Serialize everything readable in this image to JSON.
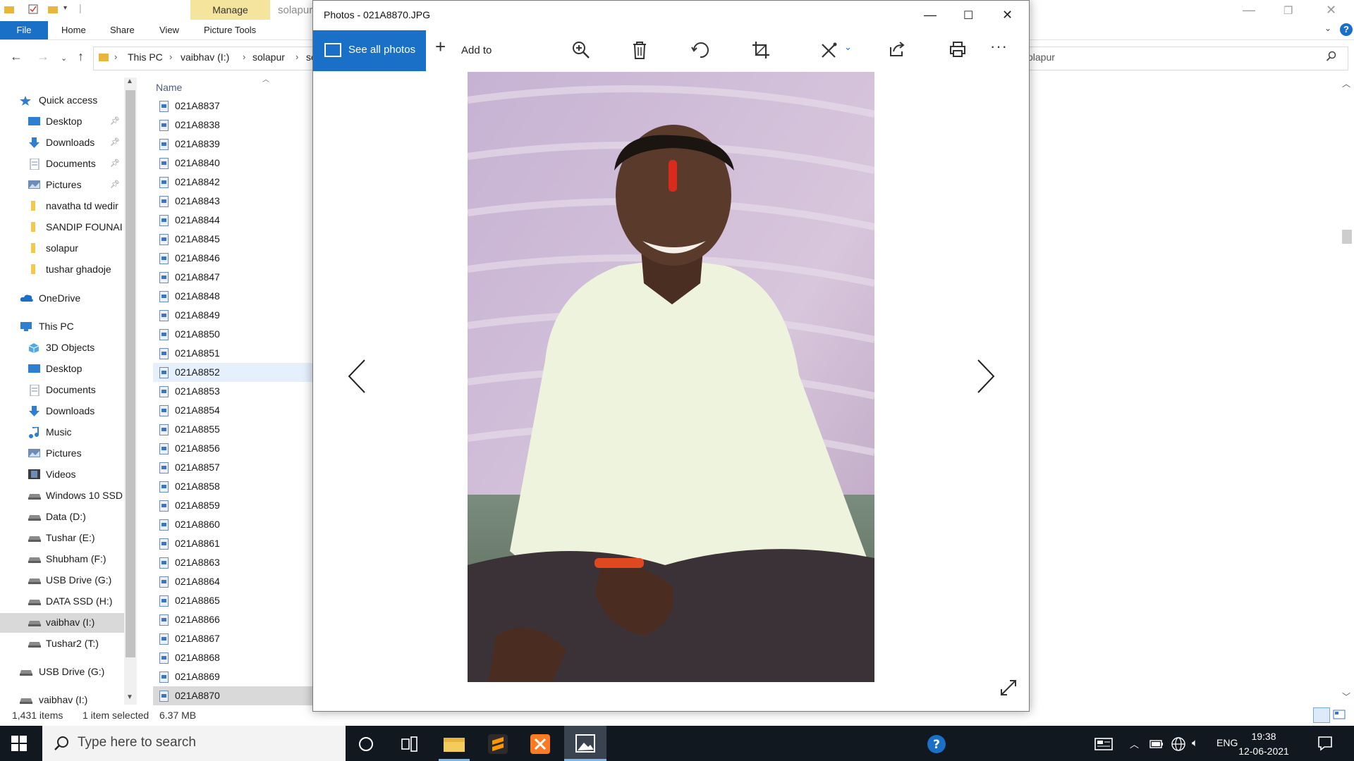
{
  "explorer": {
    "ribbon": {
      "manage_tab": "Manage",
      "file_tab": "File",
      "tabs": [
        "Home",
        "Share",
        "View",
        "Picture Tools"
      ],
      "ghost_title": "solapur"
    },
    "breadcrumb": [
      "This PC",
      "vaibhav (I:)",
      "solapur",
      "so"
    ],
    "search_text": "olapur",
    "nav_pane": [
      {
        "label": "Quick access",
        "icon": "star-icon",
        "indent": 0
      },
      {
        "label": "Desktop",
        "icon": "desktop-icon",
        "indent": 1,
        "pinned": true
      },
      {
        "label": "Downloads",
        "icon": "download-icon",
        "indent": 1,
        "pinned": true
      },
      {
        "label": "Documents",
        "icon": "documents-icon",
        "indent": 1,
        "pinned": true
      },
      {
        "label": "Pictures",
        "icon": "pictures-icon",
        "indent": 1,
        "pinned": true
      },
      {
        "label": "navatha td wedir",
        "icon": "folder-icon",
        "indent": 1
      },
      {
        "label": "SANDIP FOUNAI",
        "icon": "folder-icon",
        "indent": 1
      },
      {
        "label": "solapur",
        "icon": "folder-icon",
        "indent": 1
      },
      {
        "label": "tushar ghadoje",
        "icon": "folder-icon",
        "indent": 1
      },
      {
        "label": "OneDrive",
        "icon": "cloud-icon",
        "indent": 0
      },
      {
        "label": "This PC",
        "icon": "pc-icon",
        "indent": 0
      },
      {
        "label": "3D Objects",
        "icon": "cube-icon",
        "indent": 1
      },
      {
        "label": "Desktop",
        "icon": "desktop-icon",
        "indent": 1
      },
      {
        "label": "Documents",
        "icon": "documents-icon",
        "indent": 1
      },
      {
        "label": "Downloads",
        "icon": "download-icon",
        "indent": 1
      },
      {
        "label": "Music",
        "icon": "music-icon",
        "indent": 1
      },
      {
        "label": "Pictures",
        "icon": "pictures-icon",
        "indent": 1
      },
      {
        "label": "Videos",
        "icon": "videos-icon",
        "indent": 1
      },
      {
        "label": "Windows 10 SSD",
        "icon": "drive-icon",
        "indent": 1
      },
      {
        "label": "Data (D:)",
        "icon": "drive-icon",
        "indent": 1
      },
      {
        "label": "Tushar (E:)",
        "icon": "drive-icon",
        "indent": 1
      },
      {
        "label": "Shubham (F:)",
        "icon": "drive-icon",
        "indent": 1
      },
      {
        "label": "USB Drive (G:)",
        "icon": "drive-icon",
        "indent": 1
      },
      {
        "label": "DATA SSD (H:)",
        "icon": "drive-icon",
        "indent": 1
      },
      {
        "label": "vaibhav  (I:)",
        "icon": "drive-icon",
        "indent": 1,
        "selected": true
      },
      {
        "label": "Tushar2 (T:)",
        "icon": "drive-icon",
        "indent": 1
      },
      {
        "label": "USB Drive (G:)",
        "icon": "drive-icon",
        "indent": 0
      },
      {
        "label": "vaibhav  (I:)",
        "icon": "drive-icon",
        "indent": 0
      }
    ],
    "column_header": "Name",
    "files": [
      "021A8837",
      "021A8838",
      "021A8839",
      "021A8840",
      "021A8842",
      "021A8843",
      "021A8844",
      "021A8845",
      "021A8846",
      "021A8847",
      "021A8848",
      "021A8849",
      "021A8850",
      "021A8851",
      "021A8852",
      "021A8853",
      "021A8854",
      "021A8855",
      "021A8856",
      "021A8857",
      "021A8858",
      "021A8859",
      "021A8860",
      "021A8861",
      "021A8863",
      "021A8864",
      "021A8865",
      "021A8866",
      "021A8867",
      "021A8868",
      "021A8869",
      "021A8870"
    ],
    "hovered_file": "021A8852",
    "selected_file": "021A8870",
    "status": {
      "items": "1,431 items",
      "selected": "1 item selected",
      "size": "6.37 MB"
    }
  },
  "photos": {
    "title": "Photos - 021A8870.JPG",
    "see_all_label": "See all photos",
    "add_to_label": "Add to",
    "tools": [
      "zoom-in-icon",
      "delete-icon",
      "rotate-icon",
      "crop-icon",
      "edit-icon",
      "share-icon",
      "print-icon",
      "more-icon"
    ]
  },
  "taskbar": {
    "search_placeholder": "Type here to search",
    "language": "ENG",
    "time": "19:38",
    "date": "12-06-2021"
  },
  "colors": {
    "accent": "#1a6fc6",
    "manage": "#f4e49c",
    "taskbar": "#12181f"
  }
}
